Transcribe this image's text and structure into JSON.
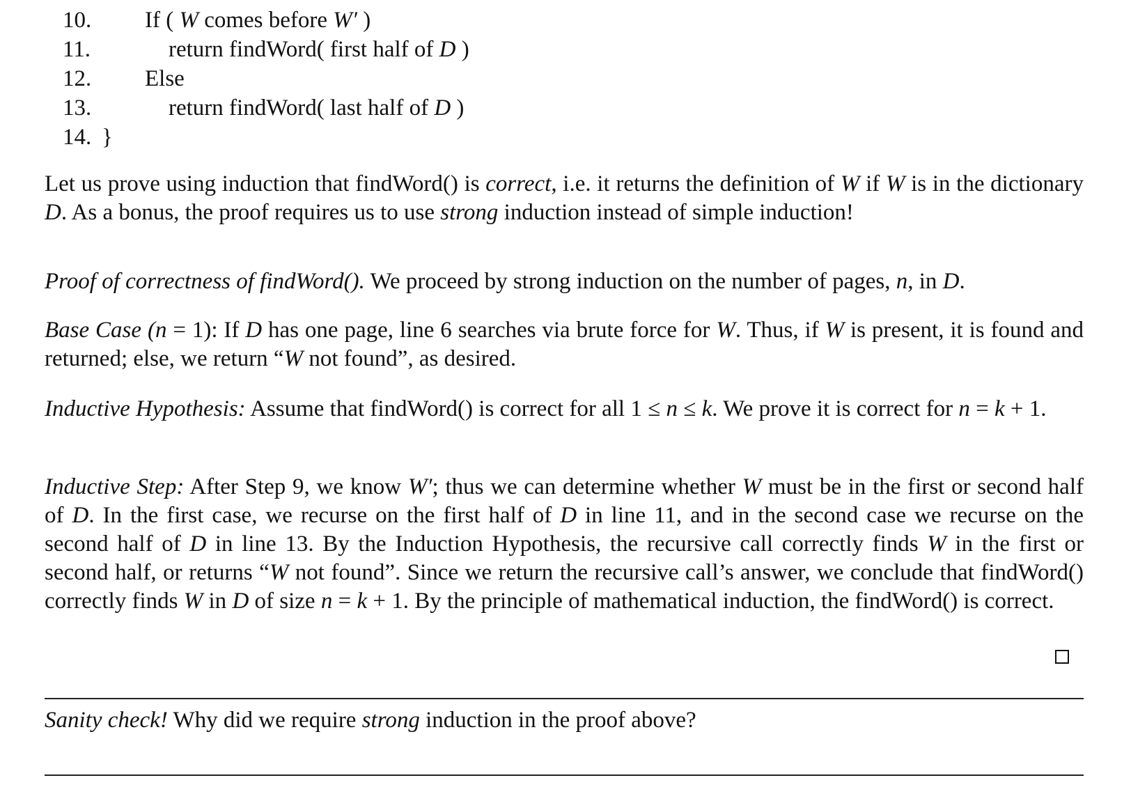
{
  "code": {
    "lines": [
      {
        "num": "10.",
        "pre": "If ( ",
        "var1": "W",
        "mid": " comes before ",
        "var2": "W′",
        "post": " )"
      },
      {
        "num": "11.",
        "pre": "return findWord( first half of ",
        "var1": "D",
        "post": " )"
      },
      {
        "num": "12.",
        "text": "Else"
      },
      {
        "num": "13.",
        "pre": "return findWord( last half of ",
        "var1": "D",
        "post": " )"
      },
      {
        "num": "14.",
        "text": "}"
      }
    ]
  },
  "intro": {
    "t1": "Let us prove using induction that findWord() is ",
    "em1": "correct",
    "t2": ", i.e.  it returns the definition of ",
    "v1": "W",
    "t3": " if ",
    "v2": "W",
    "t4": " is in the dictionary ",
    "v3": "D",
    "t5": ". As a bonus, the proof requires us to use ",
    "em2": "strong",
    "t6": " induction instead of simple induction!"
  },
  "proof_heading": {
    "label": "Proof of correctness of findWord().",
    "t1": " We proceed by strong induction on the number of pages, ",
    "v1": "n",
    "t2": ", in ",
    "v2": "D",
    "t3": "."
  },
  "base_case": {
    "label_a": "Base Case (",
    "label_var": "n",
    "label_b": " = 1):",
    "t1": " If ",
    "v1": "D",
    "t2": " has one page, line 6 searches via brute force for ",
    "v2": "W",
    "t3": ". Thus, if ",
    "v3": "W",
    "t4": " is present, it is found and returned; else, we return “",
    "v4": "W",
    "t5": " not found”, as desired."
  },
  "hypothesis": {
    "label": "Inductive Hypothesis:",
    "t1": " Assume that findWord() is correct for all 1 ≤ ",
    "v1": "n",
    "t2": " ≤ ",
    "v2": "k",
    "t3": ".  We prove it is correct for ",
    "v3": "n",
    "t4": " = ",
    "v4": "k",
    "t5": " + 1."
  },
  "step": {
    "label": "Inductive Step:",
    "t1": " After Step 9, we know ",
    "v1": "W′",
    "t2": "; thus we can determine whether ",
    "v2": "W",
    "t3": " must be in the first or second half of ",
    "v3": "D",
    "t4": ". In the first case, we recurse on the first half of ",
    "v4": "D",
    "t5": " in line 11, and in the second case we recurse on the second half of ",
    "v5": "D",
    "t6": " in line 13. By the Induction Hypothesis, the recursive call correctly finds ",
    "v6": "W",
    "t7": " in the first or second half, or returns “",
    "v7": "W",
    "t8": " not found”.  Since we return the recursive call’s answer, we conclude that findWord() correctly finds ",
    "v8": "W",
    "t9": " in ",
    "v9": "D",
    "t10": " of size ",
    "v10": "n",
    "t11": " = ",
    "v11": "k",
    "t12": " + 1.  By the principle of mathematical induction, the findWord() is correct."
  },
  "sanity": {
    "label": "Sanity check!",
    "t1": " Why did we require ",
    "em1": "strong",
    "t2": " induction in the proof above?"
  }
}
